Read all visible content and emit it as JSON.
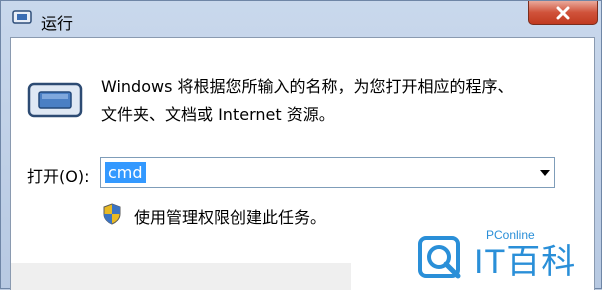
{
  "window": {
    "title": "运行"
  },
  "titlebar": {
    "close_icon": "close-icon"
  },
  "content": {
    "description_line1": "Windows 将根据您所输入的名称，为您打开相应的程序、",
    "description_line2": "文件夹、文档或 Internet 资源。",
    "open_label": "打开(O):",
    "open_value": "cmd",
    "admin_note": "使用管理权限创建此任务。"
  },
  "watermark": {
    "small": "PConline",
    "big": "IT百科"
  },
  "colors": {
    "selection": "#3399ff",
    "close": "#c13a20",
    "watermark": "#2a8fd8"
  }
}
